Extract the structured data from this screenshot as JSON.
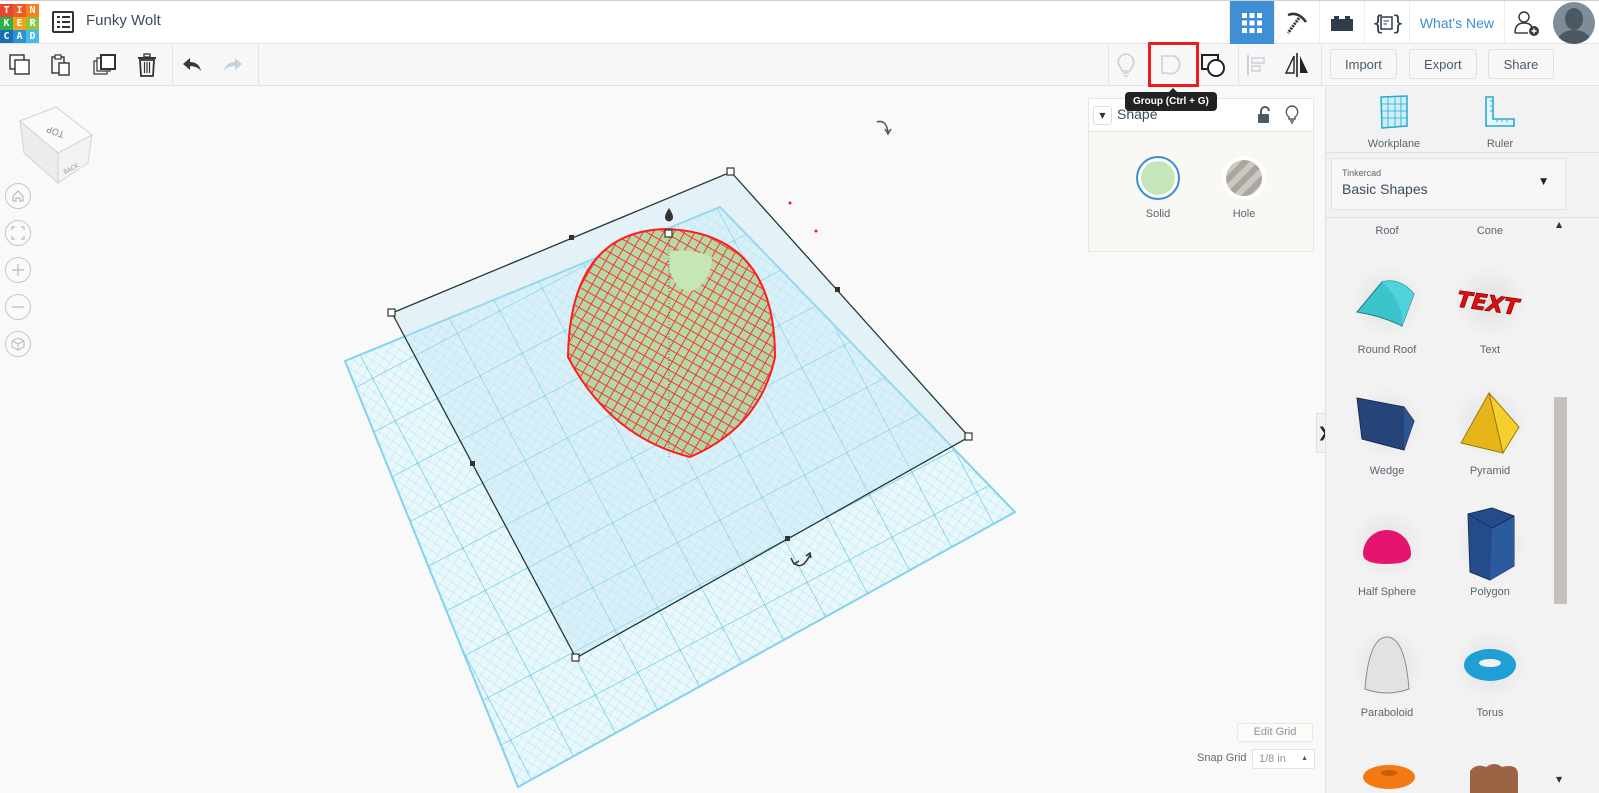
{
  "app": {
    "logo_letters": [
      "T",
      "I",
      "N",
      "K",
      "E",
      "R",
      "C",
      "A",
      "D"
    ],
    "logo_colors": [
      "#e9462f",
      "#f05a24",
      "#f58220",
      "#2db24a",
      "#f6a01a",
      "#8cc63f",
      "#1a6fb3",
      "#2a95d3",
      "#47b8e8"
    ],
    "project_title": "Funky Wolt"
  },
  "topbar": {
    "right_buttons": [
      {
        "name": "3d-design-view",
        "icon": "grid-icon",
        "active": true
      },
      {
        "name": "circuits",
        "icon": "pickaxe-icon",
        "active": false
      },
      {
        "name": "bricks",
        "icon": "brick-icon",
        "active": false
      },
      {
        "name": "codeblocks",
        "icon": "codeblocks-icon",
        "active": false
      }
    ],
    "whats_new": "What's New",
    "invite_icon": "add-user-icon",
    "avatar": "user-avatar"
  },
  "toolbar": {
    "left_tools": [
      "copy",
      "paste",
      "duplicate",
      "delete",
      "undo",
      "redo"
    ],
    "right_tools": [
      "show-hide",
      "group",
      "ungroup",
      "align",
      "mirror"
    ],
    "import": "Import",
    "export": "Export",
    "share": "Share",
    "tooltip": "Group (Ctrl + G)"
  },
  "viewcube": {
    "top": "TOP",
    "back": "BACK"
  },
  "inspector": {
    "title": "Shape",
    "solid_label": "Solid",
    "hole_label": "Hole",
    "solid_color": "#c5e6ba",
    "selected": "Solid"
  },
  "grid": {
    "edit_grid": "Edit Grid",
    "snap_grid_label": "Snap Grid",
    "snap_grid_value": "1/8 in"
  },
  "sidebar": {
    "workplane": "Workplane",
    "ruler": "Ruler",
    "library_source": "Tinkercad",
    "library_name": "Basic Shapes",
    "shapes": [
      {
        "label": "Roof"
      },
      {
        "label": "Cone"
      },
      {
        "label": "Round Roof",
        "color": "#3cc4cc"
      },
      {
        "label": "Text",
        "color": "#e01010"
      },
      {
        "label": "Wedge",
        "color": "#25457a"
      },
      {
        "label": "Pyramid",
        "color": "#f2c21e"
      },
      {
        "label": "Half Sphere",
        "color": "#e5146f"
      },
      {
        "label": "Polygon",
        "color": "#244b8a"
      },
      {
        "label": "Paraboloid",
        "color": "#e2e2e2"
      },
      {
        "label": "Torus",
        "color": "#1e9fd6"
      }
    ]
  }
}
